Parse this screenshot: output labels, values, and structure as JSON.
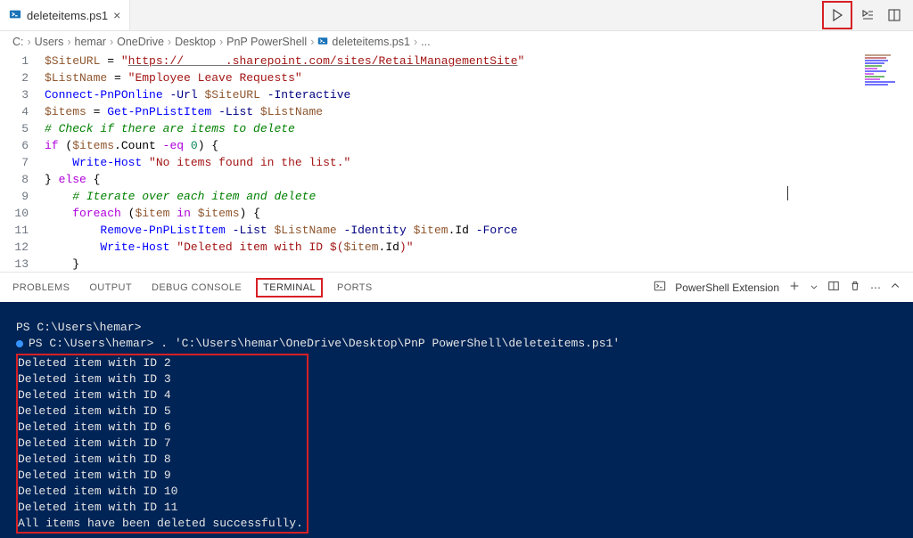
{
  "tab": {
    "filename": "deleteitems.ps1"
  },
  "breadcrumbs": {
    "parts": [
      "C:",
      "Users",
      "hemar",
      "OneDrive",
      "Desktop",
      "PnP PowerShell",
      "deleteitems.ps1",
      "..."
    ]
  },
  "code": {
    "url": "https://      .sharepoint.com/sites/RetailManagementSite",
    "listname": "Employee Leave Requests",
    "noitems_msg": "No items found in the list.",
    "deleted_prefix": "Deleted item with ID $(",
    "comment1": "# Check if there are items to delete",
    "comment2": "# Iterate over each item and delete",
    "line_numbers": [
      "1",
      "2",
      "3",
      "4",
      "5",
      "6",
      "7",
      "8",
      "9",
      "10",
      "11",
      "12",
      "13"
    ]
  },
  "panel": {
    "tabs": {
      "problems": "PROBLEMS",
      "output": "OUTPUT",
      "debug": "DEBUG CONSOLE",
      "terminal": "TERMINAL",
      "ports": "PORTS"
    },
    "shell_label": "PowerShell Extension"
  },
  "terminal": {
    "prompt1": "PS C:\\Users\\hemar>",
    "prompt2": "PS C:\\Users\\hemar>",
    "command": ". 'C:\\Users\\hemar\\OneDrive\\Desktop\\PnP PowerShell\\deleteitems.ps1'",
    "output": [
      "Deleted item with ID 2",
      "Deleted item with ID 3",
      "Deleted item with ID 4",
      "Deleted item with ID 5",
      "Deleted item with ID 6",
      "Deleted item with ID 7",
      "Deleted item with ID 8",
      "Deleted item with ID 9",
      "Deleted item with ID 10",
      "Deleted item with ID 11",
      "All items have been deleted successfully."
    ]
  }
}
